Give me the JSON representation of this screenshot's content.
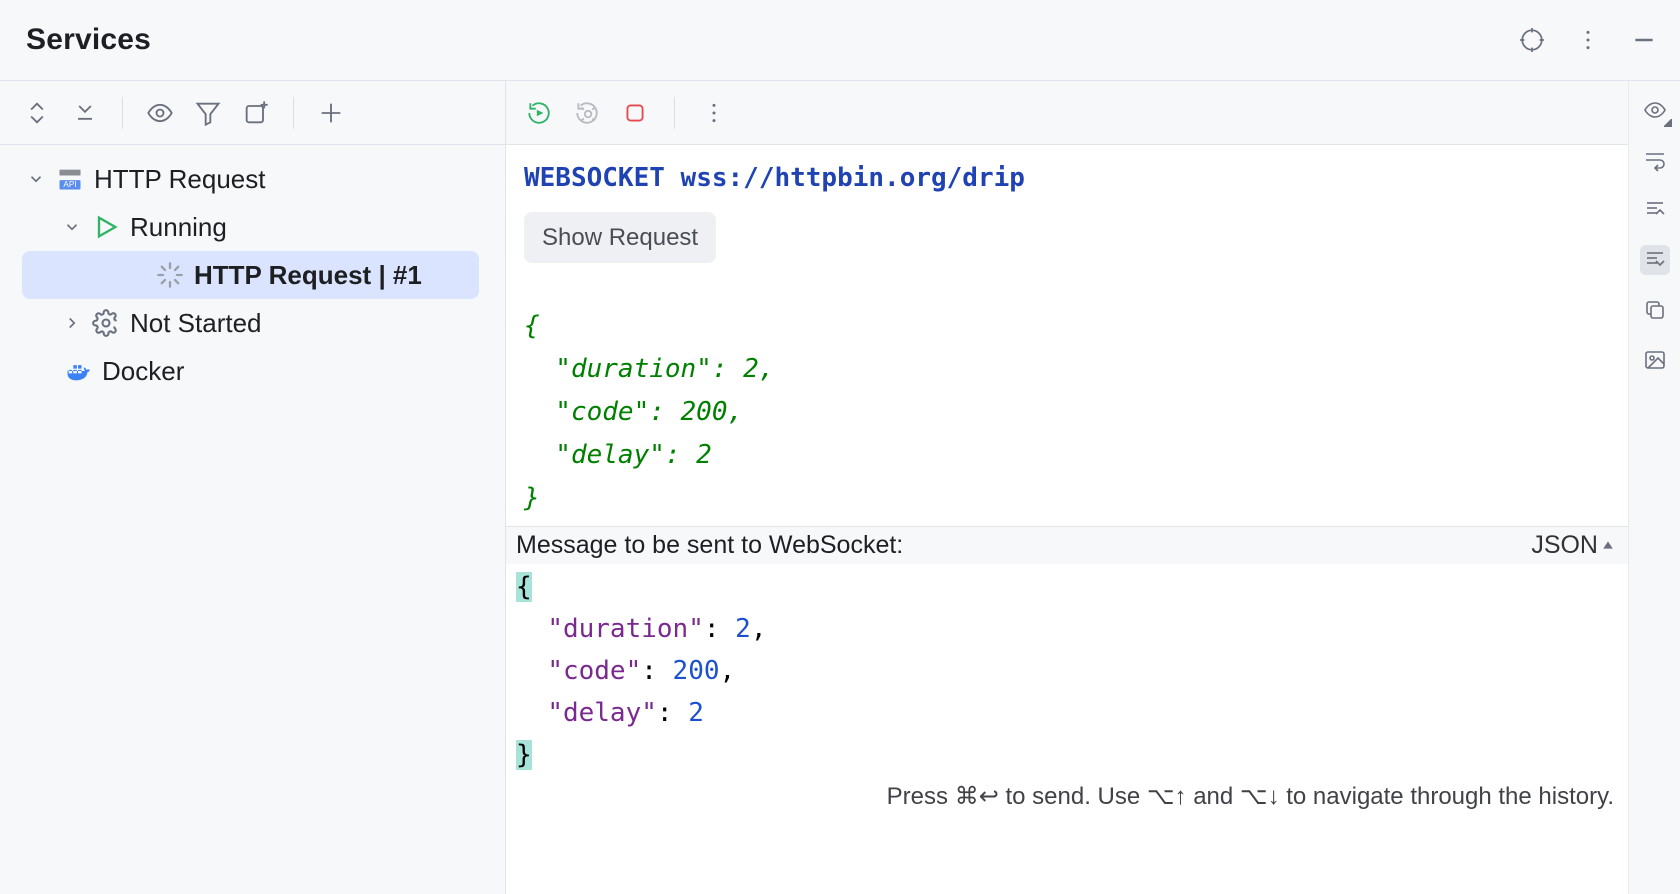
{
  "title": "Services",
  "tree": {
    "http_request": "HTTP Request",
    "running": "Running",
    "selected_item": "HTTP Request | #1",
    "not_started": "Not Started",
    "docker": "Docker"
  },
  "result": {
    "protocol": "WEBSOCKET",
    "url": "wss://httpbin.org/drip",
    "show_request": "Show Request",
    "body_lines": [
      "{",
      "  \"duration\": 2,",
      "  \"code\": 200,",
      "  \"delay\": 2",
      "}"
    ]
  },
  "message_bar": {
    "label": "Message to be sent to WebSocket:",
    "format": "JSON"
  },
  "editor": {
    "duration_key": "\"duration\"",
    "duration_val": "2",
    "code_key": "\"code\"",
    "code_val": "200",
    "delay_key": "\"delay\"",
    "delay_val": "2"
  },
  "hint": "Press ⌘↩ to send. Use ⌥↑ and ⌥↓ to navigate through the history."
}
